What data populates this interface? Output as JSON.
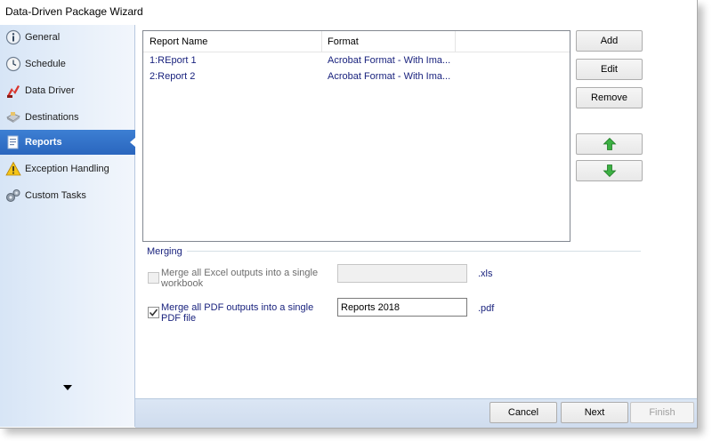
{
  "window": {
    "title": "Data-Driven Package Wizard"
  },
  "sidebar": {
    "items": [
      {
        "label": "General",
        "icon": "info-icon"
      },
      {
        "label": "Schedule",
        "icon": "clock-icon"
      },
      {
        "label": "Data Driver",
        "icon": "data-driver-icon"
      },
      {
        "label": "Destinations",
        "icon": "printer-icon"
      },
      {
        "label": "Reports",
        "icon": "report-icon",
        "active": true
      },
      {
        "label": "Exception Handling",
        "icon": "warning-icon"
      },
      {
        "label": "Custom Tasks",
        "icon": "gears-icon"
      }
    ]
  },
  "reports_list": {
    "columns": [
      "Report Name",
      "Format"
    ],
    "rows": [
      {
        "name": "1:REport 1",
        "format": "Acrobat Format - With Ima..."
      },
      {
        "name": "2:Report 2",
        "format": "Acrobat Format - With Ima..."
      }
    ]
  },
  "side_buttons": {
    "add": "Add",
    "edit": "Edit",
    "remove": "Remove"
  },
  "merging": {
    "title": "Merging",
    "excel": {
      "label": "Merge all Excel outputs into a single workbook",
      "checked": false,
      "value": "",
      "ext": ".xls"
    },
    "pdf": {
      "label": "Merge all PDF outputs into a single PDF file",
      "checked": true,
      "value": "Reports 2018",
      "ext": ".pdf"
    }
  },
  "footer": {
    "cancel": "Cancel",
    "next": "Next",
    "finish": "Finish"
  },
  "colors": {
    "accent": "#2a66be",
    "link_text": "#1a237e"
  }
}
